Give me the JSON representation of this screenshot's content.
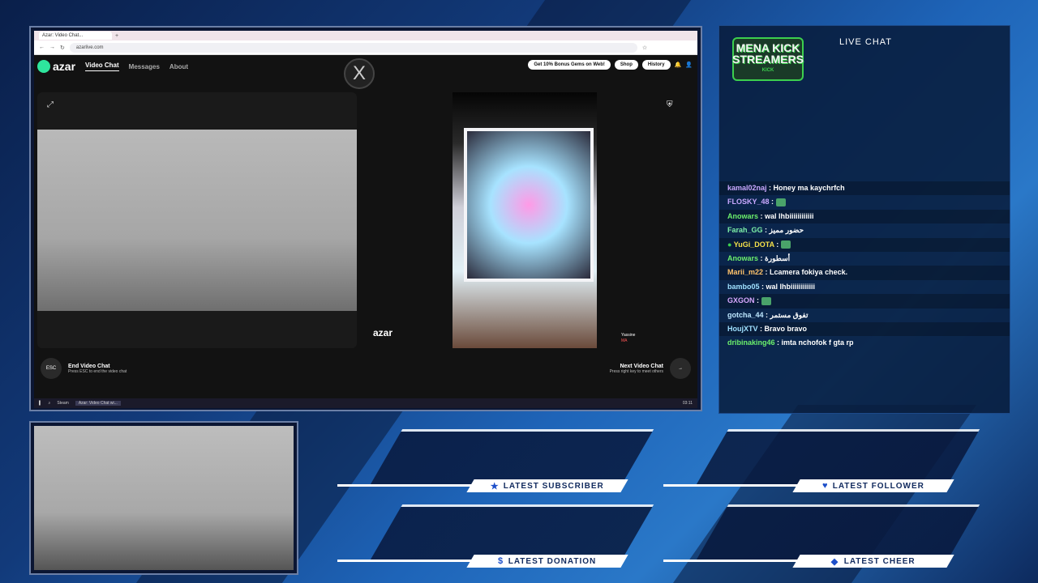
{
  "browser": {
    "tab_title": "Azar: Video Chat...",
    "url": "azarlive.com"
  },
  "azar": {
    "logo": "azar",
    "nav": [
      "Video Chat",
      "Messages",
      "About"
    ],
    "promo": "Get 10% Bonus Gems on Web!",
    "shop": "Shop",
    "history": "History",
    "end_title": "End Video Chat",
    "end_sub": "Press ESC to end the video chat",
    "esc": "ESC",
    "next_title": "Next Video Chat",
    "next_sub": "Press right key to meet others",
    "watermark": "azar",
    "partner_name": "Yassine",
    "partner_country": "MA",
    "x_logo": "X"
  },
  "taskbar": {
    "steam": "Steam",
    "active": "Azar: Video Chat wi...",
    "time": "03:11"
  },
  "chat": {
    "title": "LIVE CHAT",
    "logo_lines": [
      "MENA KICK",
      "STREAMERS"
    ],
    "logo_sub": "KICK",
    "messages": [
      {
        "user": "kamal02naj",
        "msg": "Honey ma kaychrfch",
        "color": "#c9a8ff"
      },
      {
        "user": "FLOSKY_48",
        "msg": "",
        "color": "#c9a8ff",
        "emote": true
      },
      {
        "user": "Anowars",
        "msg": "wal lhbiiiiiiiiiiii",
        "color": "#6cf06c"
      },
      {
        "user": "Farah_GG",
        "msg": "حضور مميز",
        "color": "#7df0a8"
      },
      {
        "user": "YuGi_DOTA",
        "msg": "",
        "color": "#f5e04a",
        "emote": true,
        "badge": true
      },
      {
        "user": "Anowars",
        "msg": "أسطورة",
        "color": "#6cf06c"
      },
      {
        "user": "Marii_m22",
        "msg": "Lcamera fokiya check.",
        "color": "#ffc36b"
      },
      {
        "user": "bambo05",
        "msg": "wal lhbiiiiiiiiiiii",
        "color": "#9fe0ff"
      },
      {
        "user": "GXGON",
        "msg": "",
        "color": "#d8a8ff",
        "emote": true
      },
      {
        "user": "gotcha_44",
        "msg": "تفوق مستمر",
        "color": "#bde7ff"
      },
      {
        "user": "HoujXTV",
        "msg": "Bravo bravo",
        "color": "#9fe0ff"
      },
      {
        "user": "dribinaking46",
        "msg": "imta nchofok f gta rp",
        "color": "#6cf06c"
      }
    ]
  },
  "alerts": {
    "subscriber": "LATEST SUBSCRIBER",
    "follower": "LATEST FOLLOWER",
    "donation": "LATEST DONATION",
    "cheer": "LATEST CHEER"
  }
}
